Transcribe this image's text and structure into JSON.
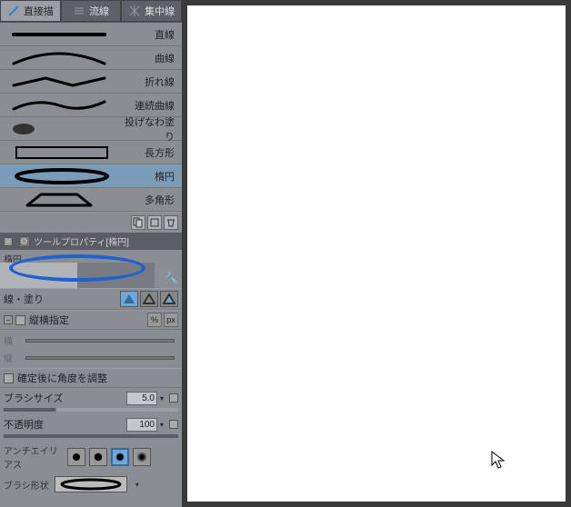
{
  "tabs": {
    "a": "直接描",
    "b": "流線",
    "c": "集中線"
  },
  "tools": [
    {
      "label": "直線"
    },
    {
      "label": "曲線"
    },
    {
      "label": "折れ線"
    },
    {
      "label": "連続曲線"
    },
    {
      "label": "投げなわ塗り"
    },
    {
      "label": "長方形"
    },
    {
      "label": "楕円"
    },
    {
      "label": "多角形"
    }
  ],
  "prop_header": "ツールプロパティ[楕円]",
  "preview_label": "楕円",
  "line_fill": "線・塗り",
  "aspect": "縦横指定",
  "aspect_w": "横",
  "aspect_h": "縦",
  "angle_after": "確定後に角度を調整",
  "brush_size": "ブラシサイズ",
  "brush_size_val": "5.0",
  "opacity": "不透明度",
  "opacity_val": "100",
  "antialias": "アンチエイリアス",
  "brush_shape": "ブラシ形状"
}
